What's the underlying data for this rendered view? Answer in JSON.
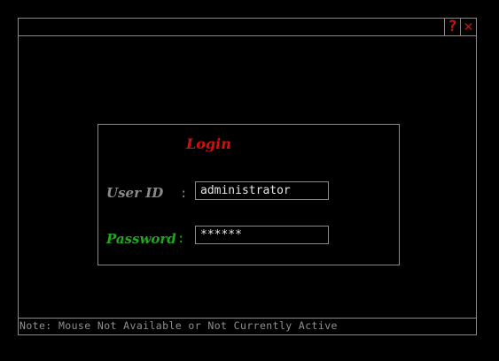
{
  "window": {
    "help_button": "?",
    "close_button": "✕"
  },
  "login": {
    "title": "Login",
    "userid_label": "User ID",
    "userid_separator": ":",
    "userid_value": "administrator",
    "password_label": "Password",
    "password_separator": ":",
    "password_value": "******"
  },
  "status": {
    "note": "Note: Mouse Not Available or Not Currently Active"
  },
  "colors": {
    "background": "#000000",
    "border": "#8a8a8a",
    "accent_red": "#d01010",
    "password_green": "#1fa81f",
    "status_text": "#8f8f8f"
  }
}
